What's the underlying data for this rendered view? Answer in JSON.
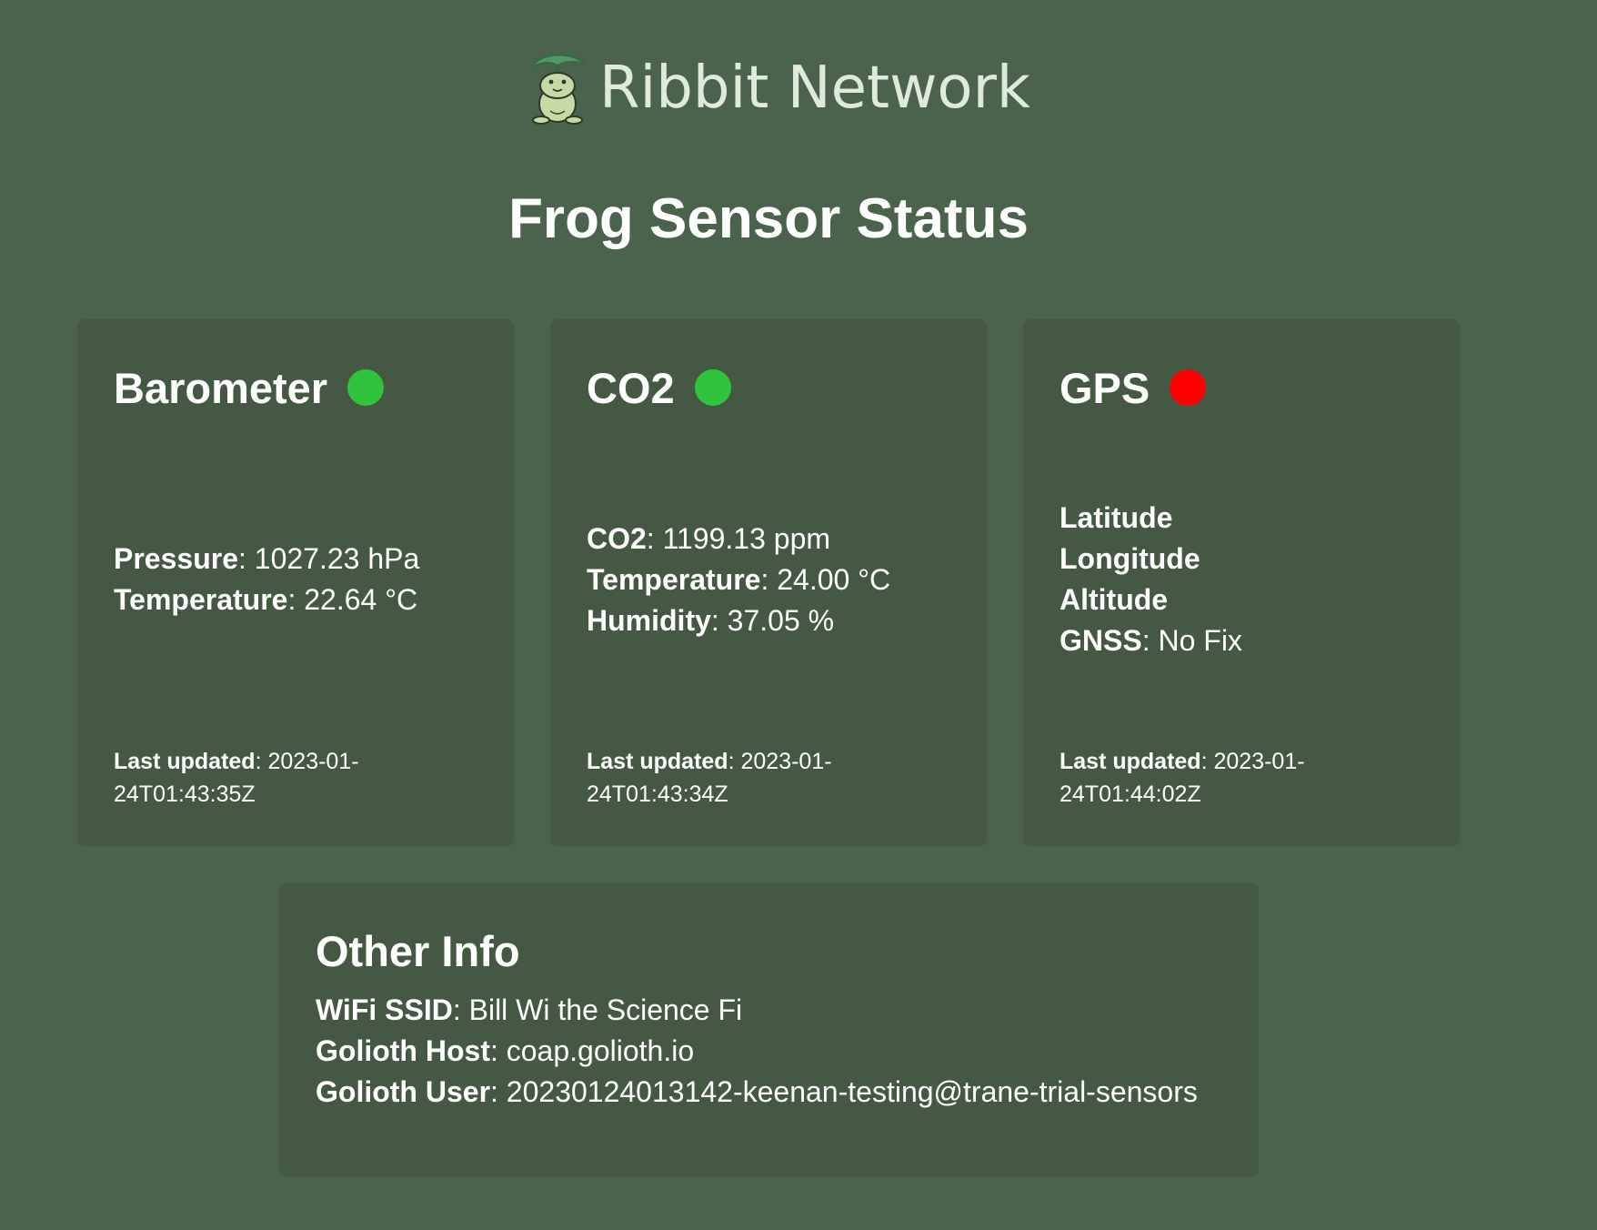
{
  "header": {
    "brand": "Ribbit Network",
    "logo_icon": "frog-leaf-logo-icon",
    "page_title": "Frog Sensor Status"
  },
  "colors": {
    "background": "#4b624c",
    "card": "#455844",
    "status_ok": "#2fc43c",
    "status_error": "#ff0000"
  },
  "cards": {
    "barometer": {
      "title": "Barometer",
      "status": "ok",
      "pressure_label": "Pressure",
      "pressure_value": "1027.23 hPa",
      "temperature_label": "Temperature",
      "temperature_value": "22.64 °C",
      "updated_label": "Last updated",
      "updated_value_1": "2023-01-",
      "updated_value_2": "24T01:43:35Z"
    },
    "co2": {
      "title": "CO2",
      "status": "ok",
      "co2_label": "CO2",
      "co2_value": "1199.13 ppm",
      "temperature_label": "Temperature",
      "temperature_value": "24.00 °C",
      "humidity_label": "Humidity",
      "humidity_value": "37.05 %",
      "updated_label": "Last updated",
      "updated_value_1": "2023-01-",
      "updated_value_2": "24T01:43:34Z"
    },
    "gps": {
      "title": "GPS",
      "status": "error",
      "latitude_label": "Latitude",
      "longitude_label": "Longitude",
      "altitude_label": "Altitude",
      "gnss_label": "GNSS",
      "gnss_value": "No Fix",
      "updated_label": "Last updated",
      "updated_value_1": "2023-01-",
      "updated_value_2": "24T01:44:02Z"
    }
  },
  "other_info": {
    "title": "Other Info",
    "wifi_label": "WiFi SSID",
    "wifi_value": "Bill Wi the Science Fi",
    "host_label": "Golioth Host",
    "host_value": "coap.golioth.io",
    "user_label": "Golioth User",
    "user_value": "20230124013142-keenan-testing@trane-trial-sensors"
  }
}
